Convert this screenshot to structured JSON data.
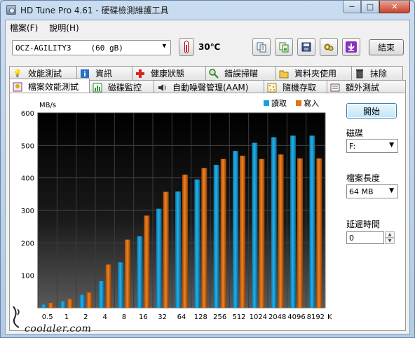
{
  "window": {
    "title": "HD Tune Pro 4.61 - 硬碟檢測維護工具",
    "controls": {
      "minimize": "−",
      "maximize": "□",
      "close": "✕"
    }
  },
  "menu": [
    {
      "label": "檔案(F)"
    },
    {
      "label": "說明(H)"
    }
  ],
  "toolbar": {
    "drive": {
      "name": "OCZ-AGILITY3",
      "capacity": "(60 gB)"
    },
    "temperature": "30℃",
    "buttons": [
      "copy-text-icon",
      "copy-image-icon",
      "save-icon",
      "options-icon",
      "download-icon"
    ],
    "exit_label": "結束"
  },
  "tabs": {
    "row1": [
      {
        "label": "效能測試",
        "icon": "lightbulb-icon"
      },
      {
        "label": "資訊",
        "icon": "info-icon"
      },
      {
        "label": "健康狀態",
        "icon": "health-cross-icon"
      },
      {
        "label": "錯誤掃瞄",
        "icon": "magnifier-icon"
      },
      {
        "label": "資料夾使用",
        "icon": "folder-icon"
      },
      {
        "label": "抹除",
        "icon": "trash-icon"
      }
    ],
    "row2": [
      {
        "label": "檔案效能測試",
        "icon": "file-benchmark-icon",
        "active": true
      },
      {
        "label": "磁碟監控",
        "icon": "monitor-chart-icon"
      },
      {
        "label": "自動噪聲管理(AAM)",
        "icon": "speaker-icon"
      },
      {
        "label": "隨機存取",
        "icon": "random-access-icon"
      },
      {
        "label": "額外測試",
        "icon": "extra-tests-icon"
      }
    ]
  },
  "side": {
    "start_label": "開始",
    "disk_label": "磁碟",
    "disk_value": "F:",
    "file_length_label": "檔案長度",
    "file_length_value": "64 MB",
    "delay_label": "延遲時間",
    "delay_value": "0"
  },
  "chart_data": {
    "type": "bar",
    "ylabel": "MB/s",
    "xunit": "KB",
    "ylim": [
      0,
      600
    ],
    "yticks": [
      100,
      200,
      300,
      400,
      500,
      600
    ],
    "categories": [
      "0.5",
      "1",
      "2",
      "4",
      "8",
      "16",
      "32",
      "64",
      "128",
      "256",
      "512",
      "1024",
      "2048",
      "4096",
      "8192"
    ],
    "series": [
      {
        "name": "讀取",
        "color": "#1a9fd6",
        "values": [
          10,
          20,
          40,
          82,
          140,
          220,
          305,
          358,
          395,
          440,
          483,
          508,
          525,
          530,
          530
        ]
      },
      {
        "name": "寫入",
        "color": "#e3720f",
        "values": [
          15,
          27,
          47,
          133,
          210,
          284,
          357,
          410,
          430,
          458,
          468,
          458,
          472,
          460,
          460
        ]
      }
    ],
    "legend_position": "top-right",
    "grid": true
  },
  "watermark": "coolaler.com"
}
